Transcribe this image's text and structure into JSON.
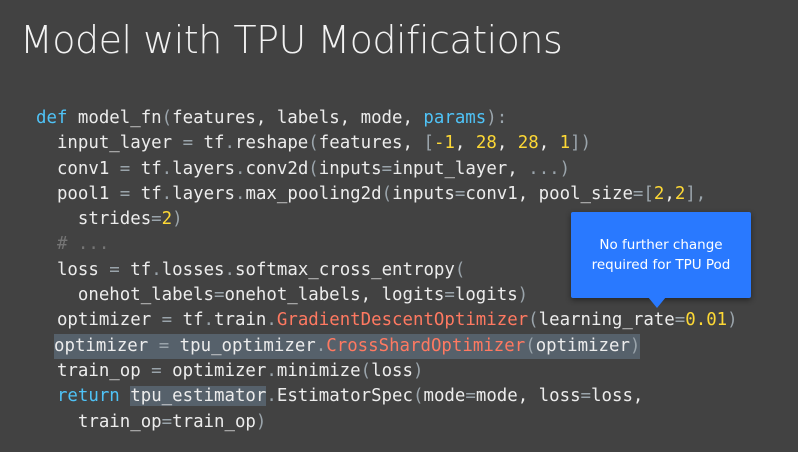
{
  "slide": {
    "title": "Model with TPU Modifications"
  },
  "code": {
    "lines": [
      [
        [
          "kw",
          "def"
        ],
        [
          "t",
          " model_fn"
        ],
        [
          "op",
          "("
        ],
        [
          "t",
          "features, labels, mode, "
        ],
        [
          "kw",
          "params"
        ],
        [
          "op",
          "):"
        ]
      ],
      [
        [
          "t",
          "  input_layer "
        ],
        [
          "op",
          "="
        ],
        [
          "t",
          " tf"
        ],
        [
          "dot",
          "."
        ],
        [
          "t",
          "reshape"
        ],
        [
          "op",
          "("
        ],
        [
          "t",
          "features, "
        ],
        [
          "op",
          "["
        ],
        [
          "num",
          "-1"
        ],
        [
          "t",
          ", "
        ],
        [
          "num",
          "28"
        ],
        [
          "t",
          ", "
        ],
        [
          "num",
          "28"
        ],
        [
          "t",
          ", "
        ],
        [
          "num",
          "1"
        ],
        [
          "op",
          "])"
        ]
      ],
      [
        [
          "t",
          "  conv1 "
        ],
        [
          "op",
          "="
        ],
        [
          "t",
          " tf"
        ],
        [
          "dot",
          "."
        ],
        [
          "t",
          "layers"
        ],
        [
          "dot",
          "."
        ],
        [
          "t",
          "conv2d"
        ],
        [
          "op",
          "("
        ],
        [
          "t",
          "inputs"
        ],
        [
          "op",
          "="
        ],
        [
          "t",
          "input_layer, "
        ],
        [
          "op",
          "...)"
        ]
      ],
      [
        [
          "t",
          "  pool1 "
        ],
        [
          "op",
          "="
        ],
        [
          "t",
          " tf"
        ],
        [
          "dot",
          "."
        ],
        [
          "t",
          "layers"
        ],
        [
          "dot",
          "."
        ],
        [
          "t",
          "max_pooling2d"
        ],
        [
          "op",
          "("
        ],
        [
          "t",
          "inputs"
        ],
        [
          "op",
          "="
        ],
        [
          "t",
          "conv1, pool_size"
        ],
        [
          "op",
          "=["
        ],
        [
          "num",
          "2"
        ],
        [
          "t",
          ","
        ],
        [
          "num",
          "2"
        ],
        [
          "op",
          "],"
        ]
      ],
      [
        [
          "t",
          "    strides"
        ],
        [
          "op",
          "="
        ],
        [
          "num",
          "2"
        ],
        [
          "op",
          ")"
        ]
      ],
      [
        [
          "cm",
          "  # ..."
        ]
      ],
      [
        [
          "t",
          "  loss "
        ],
        [
          "op",
          "="
        ],
        [
          "t",
          " tf"
        ],
        [
          "dot",
          "."
        ],
        [
          "t",
          "losses"
        ],
        [
          "dot",
          "."
        ],
        [
          "t",
          "softmax_cross_entropy"
        ],
        [
          "op",
          "("
        ]
      ],
      [
        [
          "t",
          "    onehot_labels"
        ],
        [
          "op",
          "="
        ],
        [
          "t",
          "onehot_labels, logits"
        ],
        [
          "op",
          "="
        ],
        [
          "t",
          "logits"
        ],
        [
          "op",
          ")"
        ]
      ],
      [
        [
          "t",
          "  optimizer "
        ],
        [
          "op",
          "="
        ],
        [
          "t",
          " tf"
        ],
        [
          "dot",
          "."
        ],
        [
          "t",
          "train"
        ],
        [
          "dot",
          "."
        ],
        [
          "cls",
          "GradientDescentOptimizer"
        ],
        [
          "op",
          "("
        ],
        [
          "t",
          "learning_rate"
        ],
        [
          "op",
          "="
        ],
        [
          "num",
          "0.01"
        ],
        [
          "op",
          ")"
        ]
      ],
      [
        [
          "t",
          "  optimizer "
        ],
        [
          "op",
          "="
        ],
        [
          "t",
          " tpu_optimizer"
        ],
        [
          "dot",
          "."
        ],
        [
          "cls",
          "CrossShardOptimizer"
        ],
        [
          "op",
          "("
        ],
        [
          "t",
          "optimizer"
        ],
        [
          "op",
          ")"
        ]
      ],
      [
        [
          "t",
          "  train_op "
        ],
        [
          "op",
          "="
        ],
        [
          "t",
          " optimizer"
        ],
        [
          "dot",
          "."
        ],
        [
          "t",
          "minimize"
        ],
        [
          "op",
          "("
        ],
        [
          "t",
          "loss"
        ],
        [
          "op",
          ")"
        ]
      ],
      [
        [
          "kw",
          "  return"
        ],
        [
          "t",
          " "
        ],
        [
          "hl",
          "tpu_estimator"
        ],
        [
          "dot",
          "."
        ],
        [
          "t",
          "EstimatorSpec"
        ],
        [
          "op",
          "("
        ],
        [
          "t",
          "mode"
        ],
        [
          "op",
          "="
        ],
        [
          "t",
          "mode, loss"
        ],
        [
          "op",
          "="
        ],
        [
          "t",
          "loss,"
        ]
      ],
      [
        [
          "t",
          "    train_op"
        ],
        [
          "op",
          "="
        ],
        [
          "t",
          "train_op"
        ],
        [
          "op",
          ")"
        ]
      ]
    ],
    "highlighted_line": 9
  },
  "callout": {
    "line1": "No further change",
    "line2": "required for TPU Pod",
    "color": "#2979ff"
  },
  "colors": {
    "background": "#424242",
    "keyword": "#4fc3f7",
    "number": "#fdd835",
    "class": "#ff7961",
    "highlight": "rgba(120,150,175,0.38)"
  }
}
